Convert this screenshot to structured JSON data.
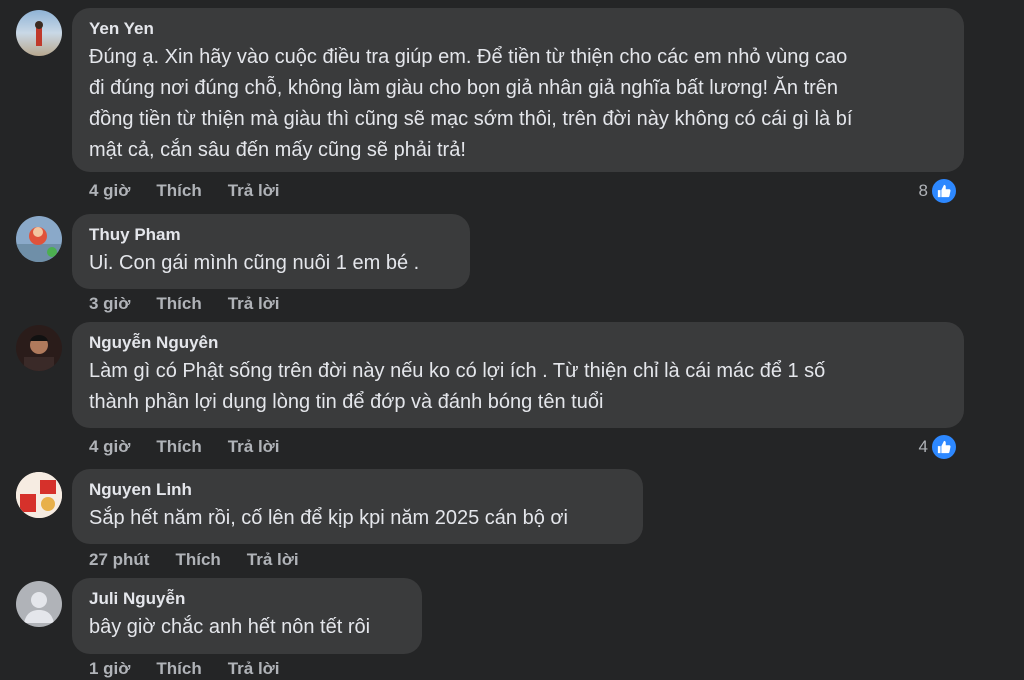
{
  "comments": [
    {
      "author": "Yen Yen",
      "text": "Đúng ạ. Xin hãy vào cuộc điều tra giúp em. Để tiền từ thiện cho các em nhỏ vùng cao\nđi đúng nơi đúng chỗ, không làm giàu cho bọn giả nhân giả nghĩa bất lương! Ăn trên\nđồng tiền từ thiện mà giàu thì cũng sẽ mạc sớm thôi, trên đời này không có cái gì là bí\nmật cả, cắn sâu đến mấy cũng sẽ phải trả!",
      "time": "4 giờ",
      "like_label": "Thích",
      "reply_label": "Trả lời",
      "reaction_count": "8"
    },
    {
      "author": "Thuy Pham",
      "text": "Ui. Con gái mình cũng nuôi 1 em bé .",
      "time": "3 giờ",
      "like_label": "Thích",
      "reply_label": "Trả lời"
    },
    {
      "author": "Nguyễn Nguyên",
      "text": "Làm gì có Phật sống trên đời này nếu ko có lợi ích . Từ thiện chỉ là cái mác để 1 số\nthành phần lợi dụng lòng tin để đớp và đánh bóng tên tuổi",
      "time": "4 giờ",
      "like_label": "Thích",
      "reply_label": "Trả lời",
      "reaction_count": "4"
    },
    {
      "author": "Nguyen Linh",
      "text": "Sắp hết năm rồi, cố lên để kịp kpi năm 2025 cán bộ ơi",
      "time": "27 phút",
      "like_label": "Thích",
      "reply_label": "Trả lời"
    },
    {
      "author": "Juli Nguyễn",
      "text": "bây giờ chắc anh hết nôn tết rôi",
      "time": "1 giờ",
      "like_label": "Thích",
      "reply_label": "Trả lời"
    }
  ],
  "colors": {
    "background": "#242526",
    "bubble": "#3a3b3c",
    "like_badge": "#2d88ff",
    "secondary_text": "#b0b3b8"
  },
  "icons": {
    "reaction": "like-thumb-icon",
    "default_avatar": "person-silhouette-icon"
  }
}
